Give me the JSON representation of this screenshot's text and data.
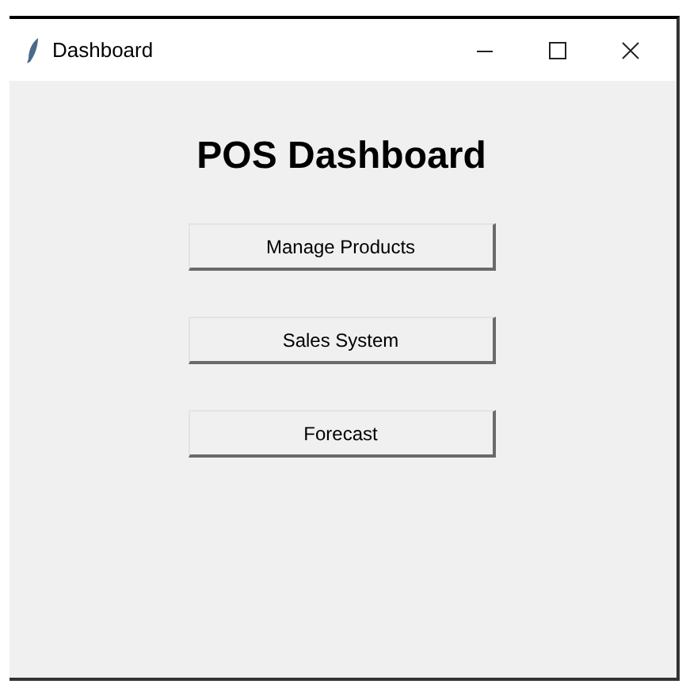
{
  "window": {
    "title": "Dashboard"
  },
  "heading": "POS Dashboard",
  "buttons": [
    {
      "label": "Manage Products"
    },
    {
      "label": "Sales System"
    },
    {
      "label": "Forecast"
    }
  ]
}
